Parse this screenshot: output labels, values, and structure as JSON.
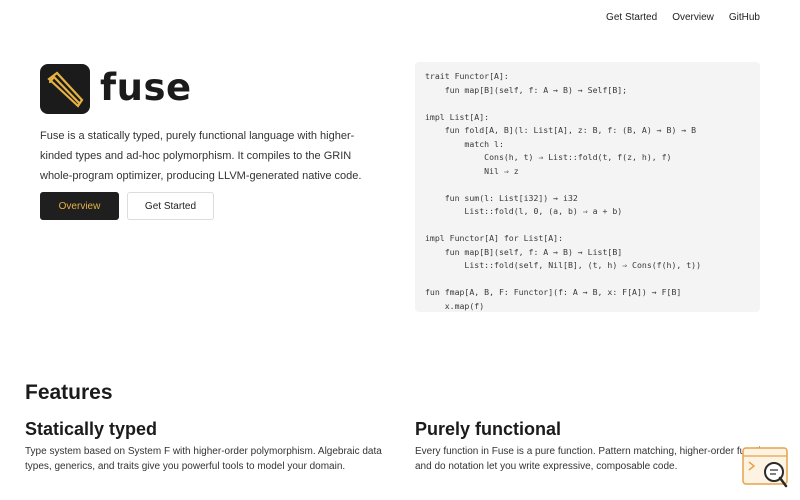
{
  "nav": {
    "items": [
      "Get Started",
      "Overview",
      "GitHub"
    ]
  },
  "hero": {
    "logo_text": "fuse",
    "description": "Fuse is a statically typed, purely functional language with higher-kinded types and ad-hoc polymorphism. It compiles to the GRIN whole-program optimizer, producing LLVM-generated native code.",
    "primary_button": "Overview",
    "secondary_button": "Get Started"
  },
  "code_sample": "trait Functor[A]:\n    fun map[B](self, f: A → B) → Self[B];\n\nimpl List[A]:\n    fun fold[A, B](l: List[A], z: B, f: (B, A) → B) → B\n        match l:\n            Cons(h, t) ⇒ List::fold(t, f(z, h), f)\n            Nil ⇒ z\n\n    fun sum(l: List[i32]) → i32\n        List::fold(l, 0, (a, b) ⇒ a + b)\n\nimpl Functor[A] for List[A]:\n    fun map[B](self, f: A → B) → List[B]\n        List::fold(self, Nil[B], (t, h) ⇒ Cons(f(h), t))\n\nfun fmap[A, B, F: Functor](f: A → B, x: F[A]) → F[B]\n    x.map(f)",
  "features": {
    "title": "Features",
    "items": [
      {
        "title": "Statically typed",
        "description": "Type system based on System F with higher-order polymorphism. Algebraic data types, generics, and traits give you powerful tools to model your domain."
      },
      {
        "title": "Purely functional",
        "description": "Every function in Fuse is a pure function. Pattern matching, higher-order functions, and do notation let you write expressive, composable code."
      }
    ]
  },
  "colors": {
    "accent": "#e7b243",
    "dark": "#1b1b1b"
  }
}
